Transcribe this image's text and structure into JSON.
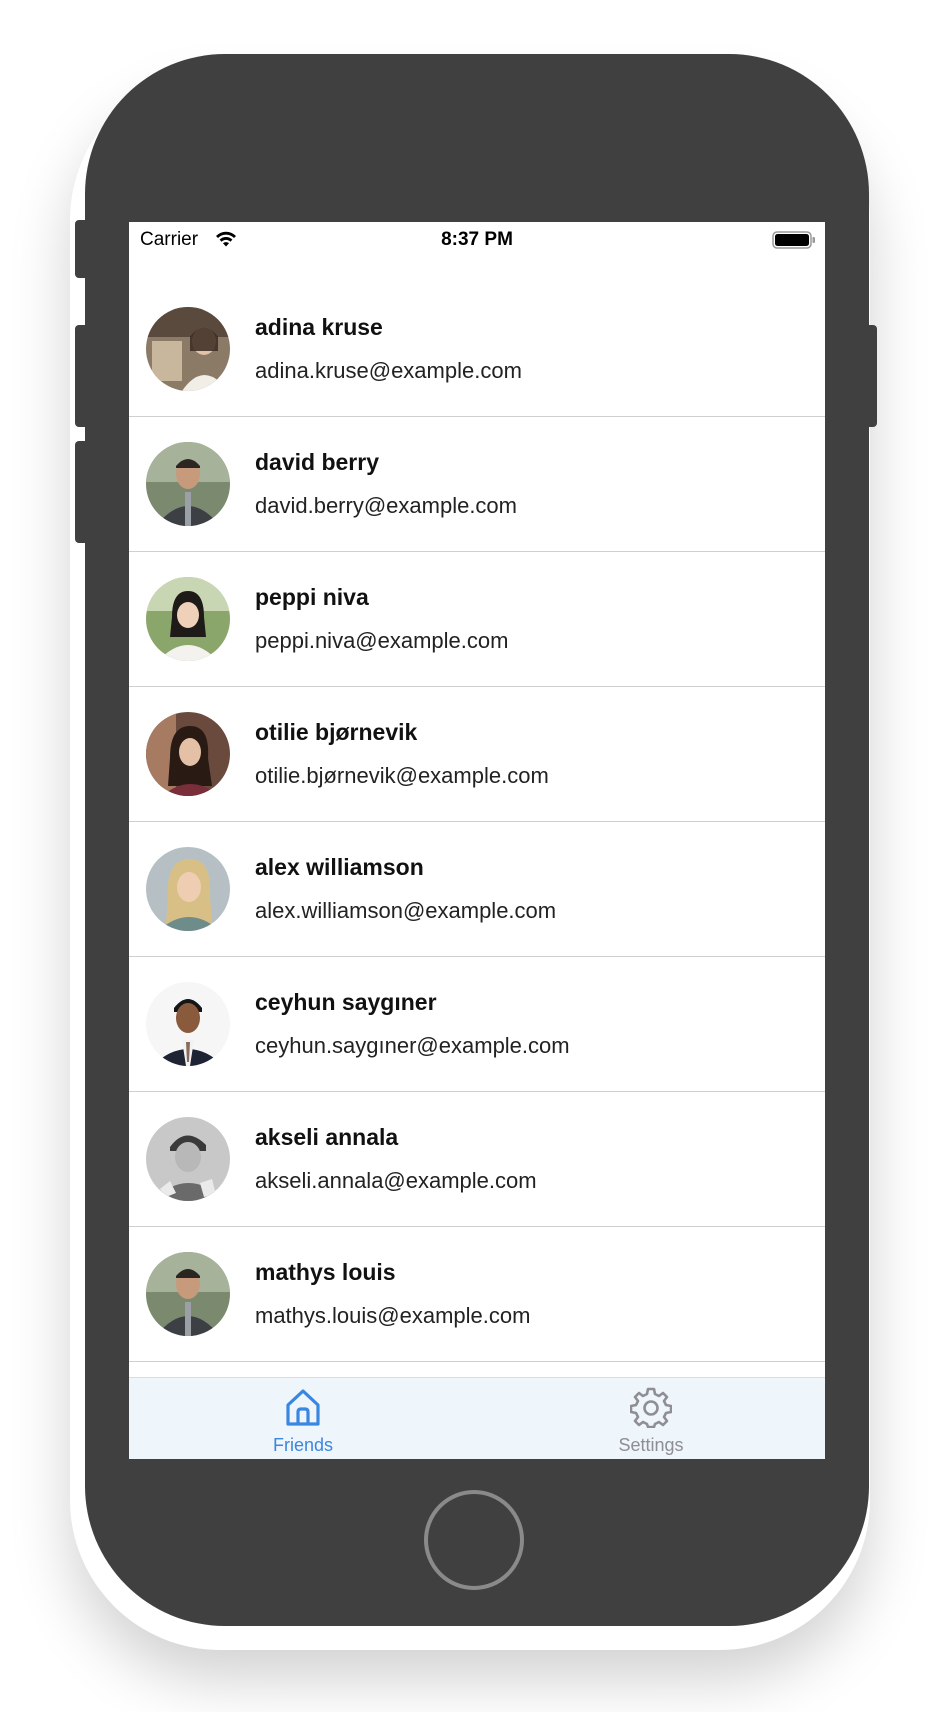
{
  "status_bar": {
    "carrier": "Carrier",
    "time": "8:37 PM",
    "wifi_icon": "wifi-icon",
    "battery_icon": "battery-icon"
  },
  "friends": [
    {
      "name": "adina kruse",
      "email": "adina.kruse@example.com"
    },
    {
      "name": "david berry",
      "email": "david.berry@example.com"
    },
    {
      "name": "peppi niva",
      "email": "peppi.niva@example.com"
    },
    {
      "name": "otilie bjørnevik",
      "email": "otilie.bjørnevik@example.com"
    },
    {
      "name": "alex williamson",
      "email": "alex.williamson@example.com"
    },
    {
      "name": "ceyhun saygıner",
      "email": "ceyhun.saygıner@example.com"
    },
    {
      "name": "akseli annala",
      "email": "akseli.annala@example.com"
    },
    {
      "name": "mathys louis",
      "email": "mathys.louis@example.com"
    }
  ],
  "tab_bar": {
    "tabs": [
      {
        "label": "Friends",
        "icon": "home-icon",
        "active": true
      },
      {
        "label": "Settings",
        "icon": "gear-icon",
        "active": false
      }
    ]
  },
  "colors": {
    "accent": "#3a87e0",
    "inactive": "#8e8e93",
    "phone_body": "#404040",
    "tab_bar_bg": "#eef5fb"
  }
}
